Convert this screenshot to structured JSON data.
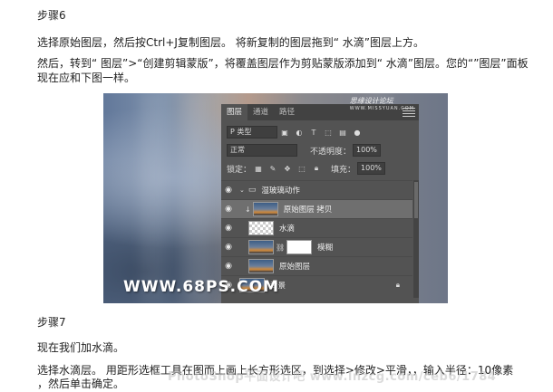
{
  "step6": {
    "heading": "步骤6",
    "para1": "选择原始图层，然后按Ctrl+J复制图层。 将新复制的图层拖到“ 水滴”图层上方。",
    "para2_line1": "然后，转到“ 图层”>“创建剪辑蒙版”，将覆盖图层作为剪贴蒙版添加到“ 水滴”图层。您的“”图层”面板",
    "para2_line2": "现在应和下图一样。"
  },
  "photo": {
    "watermark": "WWW.68PS.COM"
  },
  "panel": {
    "logo_text": "思缘设计论坛",
    "logo_sub": "WWW.MISSYUAN.COM",
    "tabs": [
      "图层",
      "通道",
      "路径"
    ],
    "filter_label": "P 类型",
    "blend_mode": "正常",
    "opacity_label": "不透明度：",
    "opacity_value": "100%",
    "lock_label": "锁定：",
    "fill_label": "填充：",
    "fill_value": "100%",
    "layers": [
      {
        "name": "湿玻璃动作"
      },
      {
        "name": "原始图层 拷贝"
      },
      {
        "name": "水滴"
      },
      {
        "name": "模糊"
      },
      {
        "name": "原始图层"
      },
      {
        "name": "背景"
      }
    ]
  },
  "step7": {
    "heading": "步骤7",
    "para1": "现在我们加水滴。",
    "para2_line1": "选择水滴层。 用距形选框工具在图而上画上长方形选区，到选择>修改>平滑，，输入半径：10像素",
    "para2_line2": "，然后单击确定。"
  },
  "footer_watermark": "PhotoShop平面设计吧 www.lnzcg.com/ceb6/1784"
}
